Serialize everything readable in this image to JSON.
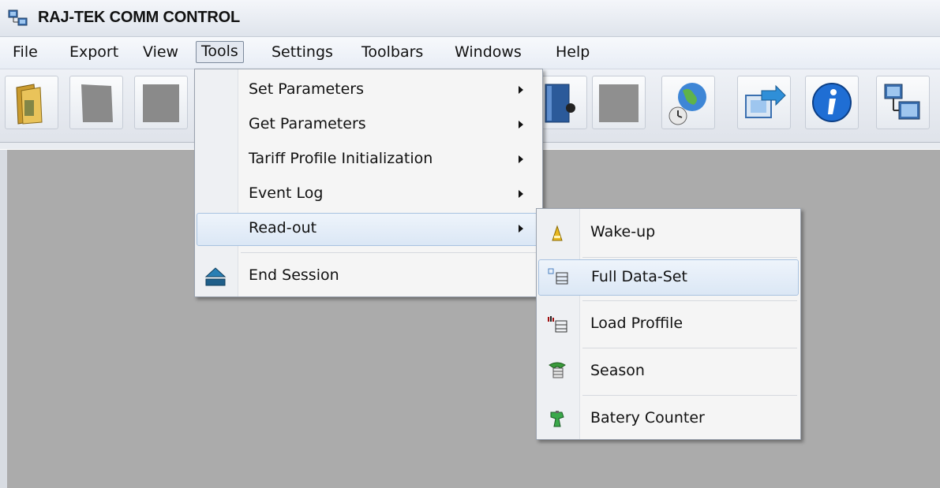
{
  "window": {
    "title": "RAJ-TEK COMM CONTROL"
  },
  "menubar": {
    "items": [
      {
        "label": "File"
      },
      {
        "label": "Export"
      },
      {
        "label": "View"
      },
      {
        "label": "Tools"
      },
      {
        "label": "Settings"
      },
      {
        "label": "Toolbars"
      },
      {
        "label": "Windows"
      },
      {
        "label": "Help"
      }
    ],
    "active": "Tools"
  },
  "tools_menu": {
    "items": [
      {
        "label": "Set Parameters",
        "has_submenu": true
      },
      {
        "label": "Get Parameters",
        "has_submenu": true
      },
      {
        "label": "Tariff Profile Initialization",
        "has_submenu": true
      },
      {
        "label": "Event Log",
        "has_submenu": true
      },
      {
        "label": "Read-out",
        "has_submenu": true,
        "highlighted": true
      },
      {
        "label": "End Session",
        "icon": "eject-icon"
      }
    ]
  },
  "readout_submenu": {
    "items": [
      {
        "label": "Wake-up",
        "icon": "wakeup-icon"
      },
      {
        "label": "Full Data-Set",
        "icon": "full-dataset-icon",
        "highlighted": true
      },
      {
        "label": "Load Proffile",
        "icon": "load-profile-icon"
      },
      {
        "label": "Season",
        "icon": "season-icon"
      },
      {
        "label": "Batery Counter",
        "icon": "battery-counter-icon"
      }
    ]
  },
  "colors": {
    "workspace": "#ababab",
    "highlight": "#dbe7f5",
    "menu_bg": "#f5f5f5"
  }
}
